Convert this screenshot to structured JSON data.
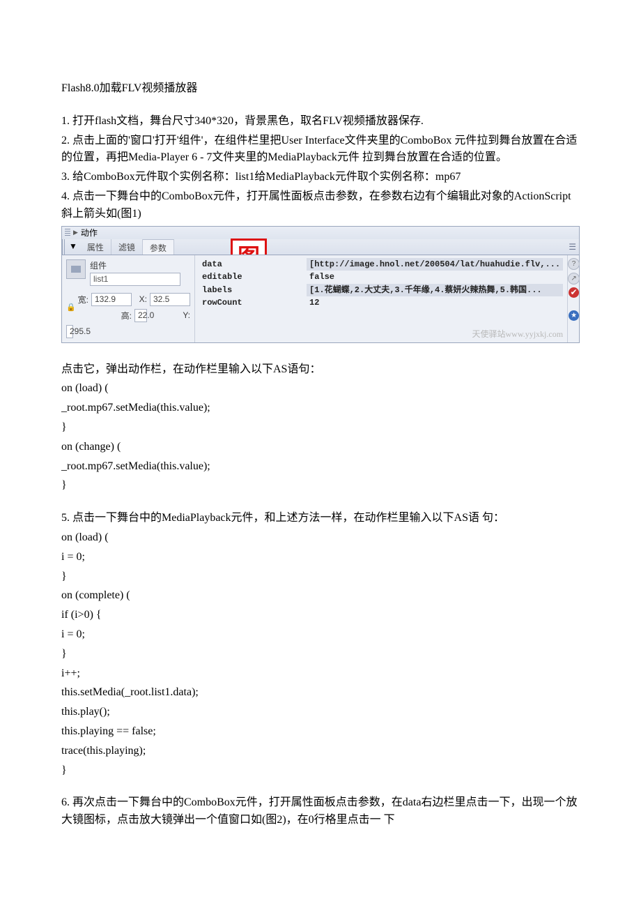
{
  "title": "Flash8.0加载FLV视频播放器",
  "steps": {
    "s1": "1.   打开flash文档，舞台尺寸340*320，背景黑色，取名FLV视频播放器保存.",
    "s2a": "2.   点击上面的'窗口'打开'组件'，在组件栏里把User Interface文件夹里的ComboBox 元件拉到舞台放置在合适的位置，再把Media-Player 6 - 7文件夹里的MediaPlayback元件   拉到舞台放置在合适的位置。",
    "s3": "3.   给ComboBox元件取个实例名称：list1给MediaPlayback元件取个实例名称：mp67",
    "s4": "4.   点击一下舞台中的ComboBox元件，打开属性面板点击参数，在参数右边有个编辑此对象的ActionScript斜上箭头如(图1)",
    "after_panel_intro": "点击它，弹出动作栏，在动作栏里输入以下AS语句：",
    "s5": "5.   点击一下舞台中的MediaPlayback元件，和上述方法一样，在动作栏里输入以下AS语   句：",
    "s6": "6.   再次点击一下舞台中的ComboBox元件，打开属性面板点击参数，在data右边栏里点击一下，出现一个放大镜图标，点击放大镜弹出一个值窗口如(图2)，在0行格里点击一   下"
  },
  "code1": [
    "on (load) (",
    "_root.mp67.setMedia(this.value);",
    "}",
    "on (change) (",
    "_root.mp67.setMedia(this.value);",
    "}"
  ],
  "code2": [
    "on (load) (",
    "i = 0;",
    "}",
    "on (complete) (",
    "if (i>0) {",
    "i = 0;",
    "}",
    "i++;",
    "this.setMedia(_root.list1.data);",
    "this.play();",
    "this.playing == false;",
    "trace(this.playing);",
    "}"
  ],
  "panel": {
    "actions_label": "动作",
    "tabs": {
      "props": "属性",
      "filters": "滤镜",
      "params": "参数"
    },
    "badge": "图",
    "component_label": "组件",
    "instance_name": "list1",
    "dims": {
      "w_label": "宽:",
      "w": "132.9",
      "x_label": "X:",
      "x": "32.5",
      "h_label": "高:",
      "h": "22.0",
      "y_label": "Y:",
      "y": "295.5"
    },
    "params": {
      "names": [
        "data",
        "editable",
        "labels",
        "rowCount"
      ],
      "values": [
        "[http://image.hnol.net/200504/lat/huahudie.flv,...",
        "false",
        "[1.花蝴蝶,2.大丈夫,3.千年缘,4.蔡妍火辣热舞,5.韩国...",
        "12"
      ]
    },
    "watermark": "天使驿站www.yyjxkj.com"
  }
}
